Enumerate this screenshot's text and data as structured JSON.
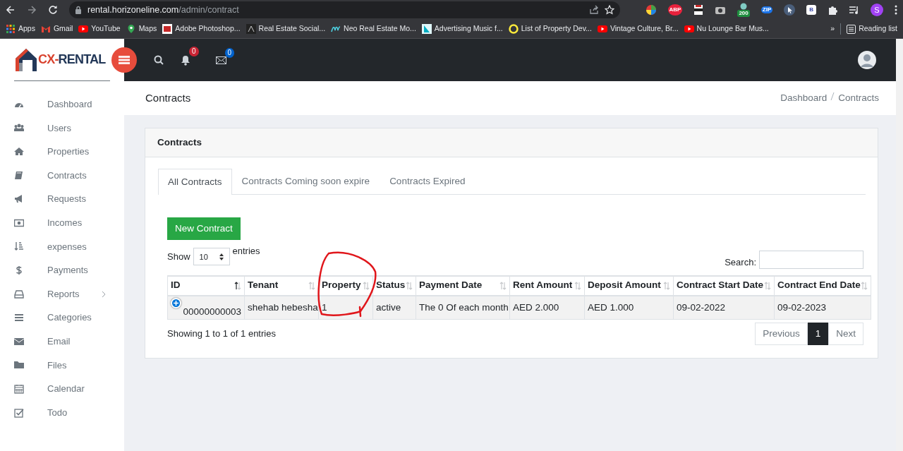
{
  "browser": {
    "url_host": "rental.horizoneline.com",
    "url_path": "/admin/contract",
    "extension_badges": [
      "ABP",
      "200",
      "ZIP",
      "B"
    ],
    "profile": "S",
    "bookmarks": [
      "Apps",
      "Gmail",
      "YouTube",
      "Maps",
      "Adobe Photoshop...",
      "Real Estate Social...",
      "Neo Real Estate Mo...",
      "Advertising Music f...",
      "List of Property Dev...",
      "Vintage Culture, Br...",
      "Nu Lounge Bar Mus..."
    ],
    "overflow": "»",
    "reading_list": "Reading list"
  },
  "brand": {
    "prefix": "CX-",
    "name": "RENTAL"
  },
  "header": {
    "notifications": "0",
    "messages": "0"
  },
  "sidebar": {
    "items": [
      {
        "label": "Dashboard",
        "has_submenu": false
      },
      {
        "label": "Users",
        "has_submenu": false
      },
      {
        "label": "Properties",
        "has_submenu": false
      },
      {
        "label": "Contracts",
        "has_submenu": false
      },
      {
        "label": "Requests",
        "has_submenu": false
      },
      {
        "label": "Incomes",
        "has_submenu": false
      },
      {
        "label": "expenses",
        "has_submenu": false
      },
      {
        "label": "Payments",
        "has_submenu": false
      },
      {
        "label": "Reports",
        "has_submenu": true
      },
      {
        "label": "Categories",
        "has_submenu": false
      },
      {
        "label": "Email",
        "has_submenu": false
      },
      {
        "label": "Files",
        "has_submenu": false
      },
      {
        "label": "Calendar",
        "has_submenu": false
      },
      {
        "label": "Todo",
        "has_submenu": false
      }
    ]
  },
  "page": {
    "title": "Contracts",
    "breadcrumb": [
      "Dashboard",
      "Contracts"
    ]
  },
  "card": {
    "title": "Contracts",
    "tabs": [
      {
        "label": "All Contracts",
        "selected": true
      },
      {
        "label": "Contracts Coming soon expire",
        "selected": false
      },
      {
        "label": "Contracts Expired",
        "selected": false
      }
    ],
    "new_button": "New Contract",
    "length": {
      "before": "Show",
      "value": "10",
      "after": "entries"
    },
    "search": {
      "label": "Search:"
    },
    "table": {
      "columns": [
        {
          "label": "ID",
          "sorted": true
        },
        {
          "label": "Tenant",
          "sorted": false
        },
        {
          "label": "Property",
          "sorted": false
        },
        {
          "label": "Status",
          "sorted": false
        },
        {
          "label": "Payment Date",
          "sorted": false
        },
        {
          "label": "Rent Amount",
          "sorted": false
        },
        {
          "label": "Deposit Amount",
          "sorted": false
        },
        {
          "label": "Contract Start Date",
          "sorted": false
        },
        {
          "label": "Contract End Date",
          "sorted": false
        }
      ],
      "rows": [
        [
          "00000000003",
          "shehab hebesha",
          "1",
          "active",
          "The 0 Of each month",
          "AED 2.000",
          "AED 1.000",
          "09-02-2022",
          "09-02-2023"
        ]
      ]
    },
    "info": "Showing 1 to 1 of 1 entries",
    "pagination": [
      {
        "label": "Previous",
        "selected": false
      },
      {
        "label": "1",
        "selected": true
      },
      {
        "label": "Next",
        "selected": false
      }
    ]
  }
}
